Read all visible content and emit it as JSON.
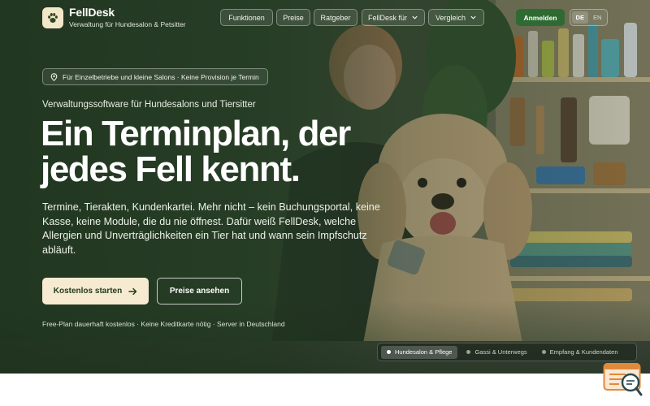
{
  "brand": {
    "name": "FellDesk",
    "tagline": "Verwaltung für Hundesalon & Petsitter",
    "logo_icon": "paw-icon"
  },
  "nav": {
    "items": [
      {
        "label": "Funktionen"
      },
      {
        "label": "Preise"
      },
      {
        "label": "Ratgeber"
      },
      {
        "label": "FellDesk für",
        "dropdown": true
      },
      {
        "label": "Vergleich",
        "dropdown": true
      }
    ],
    "login_label": "Anmelden",
    "languages": [
      "DE",
      "EN"
    ],
    "active_language": "DE"
  },
  "hero": {
    "badge": "Für Einzelbetriebe und kleine Salons · Keine Provision je Termin",
    "eyebrow": "Verwaltungssoftware für Hundesalons und Tiersitter",
    "headline_line1": "Ein Terminplan, der",
    "headline_line2": "jedes Fell kennt.",
    "lead": "Termine, Tierakten, Kundenkartei. Mehr nicht – kein Buchungsportal, keine Kasse, keine Module, die du nie öffnest. Dafür weiß FellDesk, welche Allergien und Unverträglichkeiten ein Tier hat und wann sein Impfschutz abläuft.",
    "cta_primary": "Kostenlos starten",
    "cta_secondary": "Preise ansehen",
    "fineprint": "Free-Plan dauerhaft kostenlos · Keine Kreditkarte nötig · Server in Deutschland"
  },
  "scenes": {
    "items": [
      {
        "label": "Hundesalon & Pflege",
        "active": true
      },
      {
        "label": "Gassi & Unterwegs",
        "active": false
      },
      {
        "label": "Empfang & Kundendaten",
        "active": false
      }
    ]
  },
  "colors": {
    "brand_green": "#2f6a32",
    "cta_cream": "#f6ead0",
    "chat_orange": "#e08a3c"
  }
}
